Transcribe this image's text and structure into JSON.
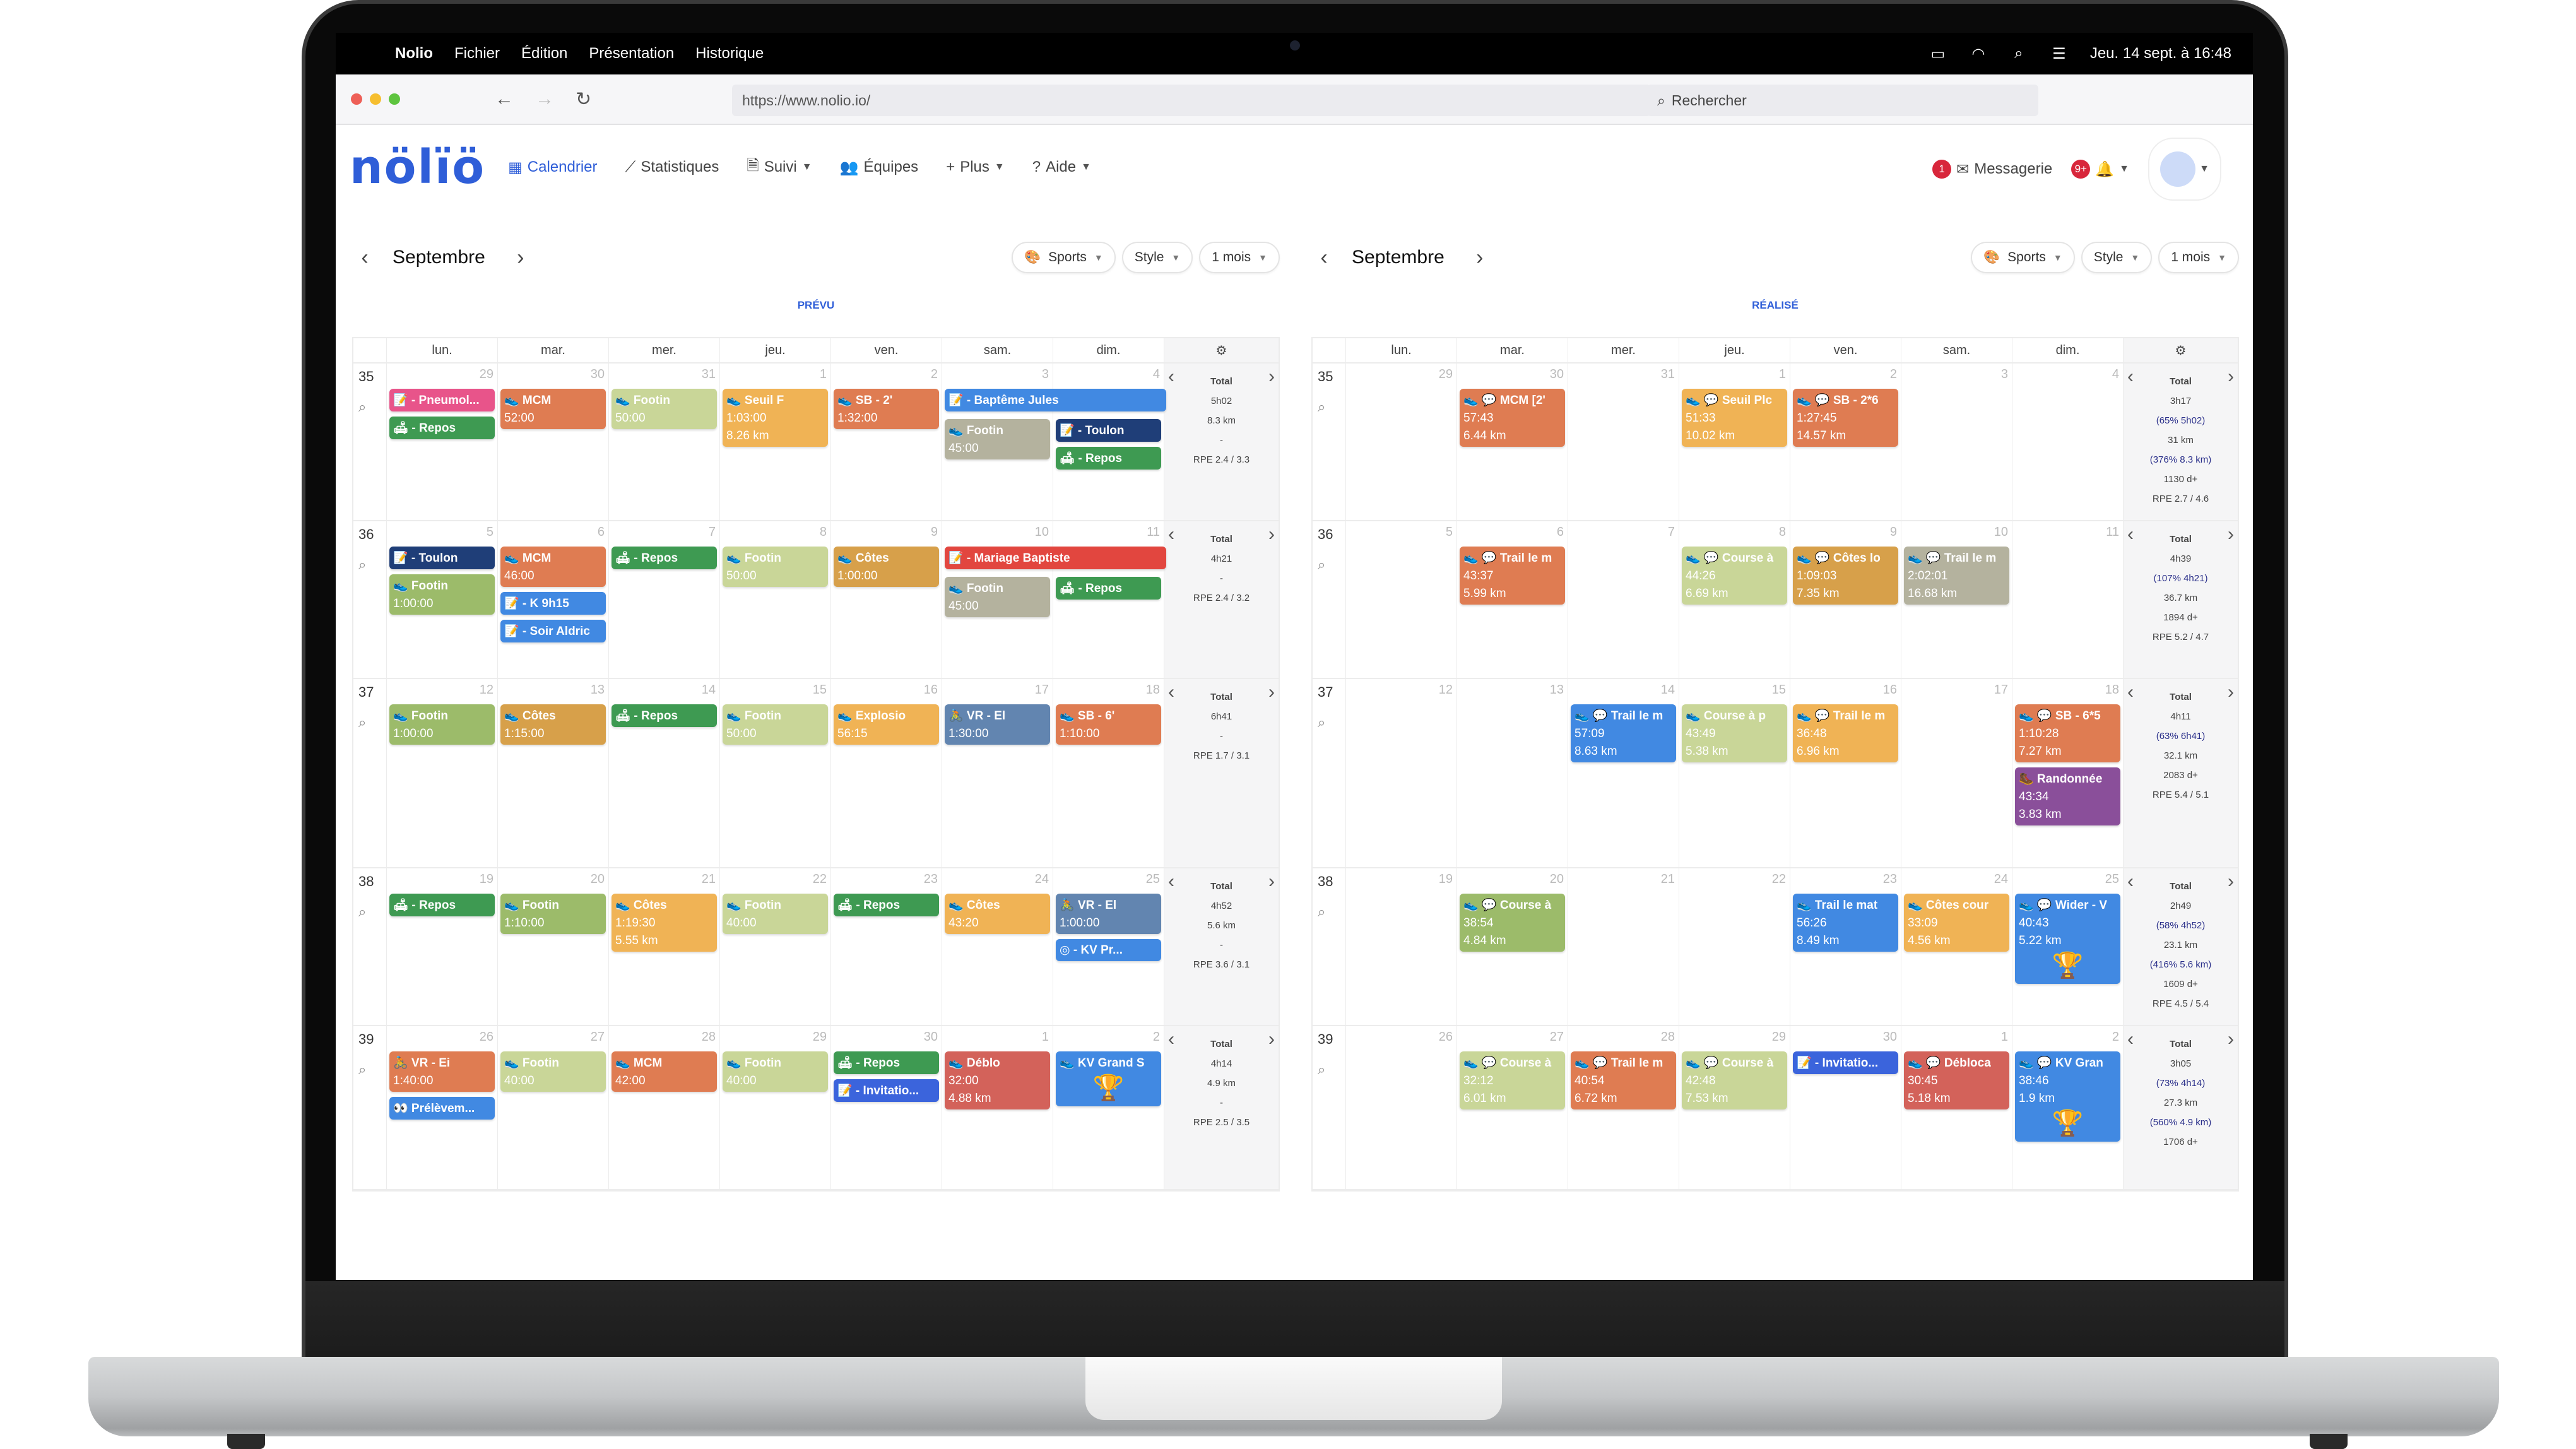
{
  "menubar": {
    "app": "Nolio",
    "items": [
      "Fichier",
      "Édition",
      "Présentation",
      "Historique"
    ],
    "datetime": "Jeu. 14 sept. à 16:48"
  },
  "browser": {
    "url": "https://www.nolio.io/",
    "search_placeholder": "Rechercher"
  },
  "app": {
    "logo": "nölïö",
    "nav": [
      {
        "label": "Calendrier",
        "icon": "calendar-icon",
        "active": true
      },
      {
        "label": "Statistiques",
        "icon": "chart-icon"
      },
      {
        "label": "Suivi",
        "icon": "document-icon",
        "dropdown": true
      },
      {
        "label": "Équipes",
        "icon": "team-icon"
      },
      {
        "label": "Plus",
        "icon": "plus-icon",
        "dropdown": true
      },
      {
        "label": "Aide",
        "icon": "question-icon",
        "dropdown": true
      }
    ],
    "messages_label": "Messagerie",
    "messages_badge": "1",
    "notifications_badge": "9+"
  },
  "days": [
    "lun.",
    "mar.",
    "mer.",
    "jeu.",
    "ven.",
    "sam.",
    "dim."
  ],
  "calendars": [
    {
      "month": "Septembre",
      "label": "PRÉVU",
      "filters": {
        "sports": "Sports",
        "style": "Style",
        "range": "1 mois"
      },
      "weeks": [
        {
          "num": "35",
          "dates": [
            "29",
            "30",
            "31",
            "1",
            "2",
            "3",
            "4"
          ],
          "total": [
            "Total",
            "5h02",
            "8.3 km",
            "-",
            "RPE 2.4 / 3.3"
          ],
          "days": [
            [
              {
                "c": "#e8548a",
                "t": "📝 - Pneumol...",
                "l": []
              },
              {
                "c": "#3e9a52",
                "t": "🛋 - Repos",
                "l": []
              }
            ],
            [
              {
                "c": "#df7c52",
                "t": "👟 MCM",
                "l": [
                  "52:00"
                ]
              }
            ],
            [
              {
                "c": "#c9d698",
                "t": "👟 Footin",
                "l": [
                  "50:00"
                ]
              }
            ],
            [
              {
                "c": "#f0b355",
                "t": "👟 Seuil F",
                "l": [
                  "1:03:00",
                  "8.26 km"
                ]
              }
            ],
            [
              {
                "c": "#df7c52",
                "t": "👟 SB - 2'",
                "l": [
                  "1:32:00"
                ]
              }
            ],
            [
              {
                "c": "#4189e2",
                "t": "📝 - Baptême Jules",
                "l": [],
                "span": 2
              },
              {
                "c": "#b4b29e",
                "t": "👟 Footin",
                "l": [
                  "45:00"
                ]
              }
            ],
            [
              {
                "c": "#1f3e78",
                "t": "📝 - Toulon",
                "l": []
              },
              {
                "c": "#3e9a52",
                "t": "🛋 - Repos",
                "l": []
              }
            ]
          ]
        },
        {
          "num": "36",
          "dates": [
            "5",
            "6",
            "7",
            "8",
            "9",
            "10",
            "11"
          ],
          "total": [
            "Total",
            "4h21",
            "-",
            "RPE 2.4 / 3.2"
          ],
          "days": [
            [
              {
                "c": "#1f3e78",
                "t": "📝 - Toulon",
                "l": []
              },
              {
                "c": "#9cbb6a",
                "t": "👟 Footin",
                "l": [
                  "1:00:00"
                ]
              }
            ],
            [
              {
                "c": "#df7c52",
                "t": "👟 MCM",
                "l": [
                  "46:00"
                ]
              },
              {
                "c": "#4189e2",
                "t": "📝 - K 9h15",
                "l": []
              },
              {
                "c": "#4189e2",
                "t": "📝 - Soir Aldric",
                "l": []
              }
            ],
            [
              {
                "c": "#3e9a52",
                "t": "🛋 - Repos",
                "l": []
              }
            ],
            [
              {
                "c": "#c9d698",
                "t": "👟 Footin",
                "l": [
                  "50:00"
                ]
              }
            ],
            [
              {
                "c": "#d7a04a",
                "t": "👟 Côtes",
                "l": [
                  "1:00:00"
                ]
              }
            ],
            [
              {
                "c": "#e2463f",
                "t": "📝 - Mariage Baptiste",
                "l": [],
                "span": 2
              },
              {
                "c": "#b4b29e",
                "t": "👟 Footin",
                "l": [
                  "45:00"
                ]
              }
            ],
            [
              {
                "c": "#3e9a52",
                "t": "🛋 - Repos",
                "l": []
              }
            ]
          ]
        },
        {
          "num": "37",
          "dates": [
            "12",
            "13",
            "14",
            "15",
            "16",
            "17",
            "18"
          ],
          "total": [
            "Total",
            "6h41",
            "-",
            "RPE 1.7 / 3.1"
          ],
          "days": [
            [
              {
                "c": "#9cbb6a",
                "t": "👟 Footin",
                "l": [
                  "1:00:00"
                ]
              }
            ],
            [
              {
                "c": "#d7a04a",
                "t": "👟 Côtes",
                "l": [
                  "1:15:00"
                ]
              }
            ],
            [
              {
                "c": "#3e9a52",
                "t": "🛋 - Repos",
                "l": []
              }
            ],
            [
              {
                "c": "#c9d698",
                "t": "👟 Footin",
                "l": [
                  "50:00"
                ]
              }
            ],
            [
              {
                "c": "#f0b355",
                "t": "👟 Explosio",
                "l": [
                  "56:15"
                ]
              }
            ],
            [
              {
                "c": "#6285b0",
                "t": "🚴 VR - El",
                "l": [
                  "1:30:00"
                ]
              }
            ],
            [
              {
                "c": "#df7c52",
                "t": "👟 SB - 6'",
                "l": [
                  "1:10:00"
                ]
              }
            ]
          ]
        },
        {
          "num": "38",
          "dates": [
            "19",
            "20",
            "21",
            "22",
            "23",
            "24",
            "25"
          ],
          "total": [
            "Total",
            "4h52",
            "5.6 km",
            "-",
            "RPE 3.6 / 3.1"
          ],
          "days": [
            [
              {
                "c": "#3e9a52",
                "t": "🛋 - Repos",
                "l": []
              }
            ],
            [
              {
                "c": "#9cbb6a",
                "t": "👟 Footin",
                "l": [
                  "1:10:00"
                ]
              }
            ],
            [
              {
                "c": "#f0b355",
                "t": "👟 Côtes",
                "l": [
                  "1:19:30",
                  "5.55 km"
                ]
              }
            ],
            [
              {
                "c": "#c9d698",
                "t": "👟 Footin",
                "l": [
                  "40:00"
                ]
              }
            ],
            [
              {
                "c": "#3e9a52",
                "t": "🛋 - Repos",
                "l": []
              }
            ],
            [
              {
                "c": "#f0b355",
                "t": "👟 Côtes",
                "l": [
                  "43:20"
                ]
              }
            ],
            [
              {
                "c": "#6285b0",
                "t": "🚴 VR - El",
                "l": [
                  "1:00:00"
                ]
              },
              {
                "c": "#4189e2",
                "t": "◎ - KV Pr...",
                "l": []
              }
            ]
          ]
        },
        {
          "num": "39",
          "dates": [
            "26",
            "27",
            "28",
            "29",
            "30",
            "1",
            "2"
          ],
          "total": [
            "Total",
            "4h14",
            "4.9 km",
            "-",
            "RPE 2.5 / 3.5"
          ],
          "days": [
            [
              {
                "c": "#df7c52",
                "t": "🚴 VR - Ei",
                "l": [
                  "1:40:00"
                ]
              },
              {
                "c": "#4189e2",
                "t": "👀 Prélèvem...",
                "l": []
              }
            ],
            [
              {
                "c": "#c9d698",
                "t": "👟 Footin",
                "l": [
                  "40:00"
                ]
              }
            ],
            [
              {
                "c": "#df7c52",
                "t": "👟 MCM",
                "l": [
                  "42:00"
                ]
              }
            ],
            [
              {
                "c": "#c9d698",
                "t": "👟 Footin",
                "l": [
                  "40:00"
                ]
              }
            ],
            [
              {
                "c": "#3e9a52",
                "t": "🛋 - Repos",
                "l": []
              },
              {
                "c": "#3b64dc",
                "t": "📝 - Invitatio...",
                "l": []
              }
            ],
            [
              {
                "c": "#d3625a",
                "t": "👟 Déblo",
                "l": [
                  "32:00",
                  "4.88 km"
                ]
              }
            ],
            [
              {
                "c": "#4189e2",
                "t": "👟 KV Grand S",
                "l": [],
                "trophy": true
              }
            ]
          ]
        }
      ]
    },
    {
      "month": "Septembre",
      "label": "RÉALISÉ",
      "filters": {
        "sports": "Sports",
        "style": "Style",
        "range": "1 mois"
      },
      "weeks": [
        {
          "num": "35",
          "dates": [
            "29",
            "30",
            "31",
            "1",
            "2",
            "3",
            "4"
          ],
          "total": [
            "Total",
            "3h17",
            "(65% 5h02)",
            "31 km",
            "(376% 8.3 km)",
            "1130 d+",
            "RPE 2.7 / 4.6"
          ],
          "days": [
            [],
            [
              {
                "c": "#df7c52",
                "t": "👟 💬 MCM [2'",
                "l": [
                  "57:43",
                  "6.44 km"
                ]
              }
            ],
            [],
            [
              {
                "c": "#f0b355",
                "t": "👟 💬 Seuil Plc",
                "l": [
                  "51:33",
                  "10.02 km"
                ]
              }
            ],
            [
              {
                "c": "#df7c52",
                "t": "👟 💬 SB - 2*6",
                "l": [
                  "1:27:45",
                  "14.57 km"
                ]
              }
            ],
            [],
            []
          ]
        },
        {
          "num": "36",
          "dates": [
            "5",
            "6",
            "7",
            "8",
            "9",
            "10",
            "11"
          ],
          "total": [
            "Total",
            "4h39",
            "(107% 4h21)",
            "36.7 km",
            "1894 d+",
            "RPE 5.2 / 4.7"
          ],
          "days": [
            [],
            [
              {
                "c": "#df7c52",
                "t": "👟 💬 Trail le m",
                "l": [
                  "43:37",
                  "5.99 km"
                ]
              }
            ],
            [],
            [
              {
                "c": "#c9d698",
                "t": "👟 💬 Course à",
                "l": [
                  "44:26",
                  "6.69 km"
                ]
              }
            ],
            [
              {
                "c": "#d7a04a",
                "t": "👟 💬 Côtes lo",
                "l": [
                  "1:09:03",
                  "7.35 km"
                ]
              }
            ],
            [
              {
                "c": "#b4b29e",
                "t": "👟 💬 Trail le m",
                "l": [
                  "2:02:01",
                  "16.68 km"
                ]
              }
            ],
            []
          ]
        },
        {
          "num": "37",
          "dates": [
            "12",
            "13",
            "14",
            "15",
            "16",
            "17",
            "18"
          ],
          "total": [
            "Total",
            "4h11",
            "(63% 6h41)",
            "32.1 km",
            "2083 d+",
            "RPE 5.4 / 5.1"
          ],
          "days": [
            [],
            [],
            [
              {
                "c": "#4189e2",
                "t": "👟 💬 Trail le m",
                "l": [
                  "57:09",
                  "8.63 km"
                ]
              }
            ],
            [
              {
                "c": "#c9d698",
                "t": "👟 Course à p",
                "l": [
                  "43:49",
                  "5.38 km"
                ]
              }
            ],
            [
              {
                "c": "#f0b355",
                "t": "👟 💬 Trail le m",
                "l": [
                  "36:48",
                  "6.96 km"
                ]
              }
            ],
            [],
            [
              {
                "c": "#df7c52",
                "t": "👟 💬 SB - 6*5",
                "l": [
                  "1:10:28",
                  "7.27 km"
                ]
              },
              {
                "c": "#8a4f9a",
                "t": "🥾 Randonnée",
                "l": [
                  "43:34",
                  "3.83 km"
                ]
              }
            ]
          ]
        },
        {
          "num": "38",
          "dates": [
            "19",
            "20",
            "21",
            "22",
            "23",
            "24",
            "25"
          ],
          "total": [
            "Total",
            "2h49",
            "(58% 4h52)",
            "23.1 km",
            "(416% 5.6 km)",
            "1609 d+",
            "RPE 4.5 / 5.4"
          ],
          "days": [
            [],
            [
              {
                "c": "#9cbb6a",
                "t": "👟 💬 Course à",
                "l": [
                  "38:54",
                  "4.84 km"
                ]
              }
            ],
            [],
            [],
            [
              {
                "c": "#4189e2",
                "t": "👟 Trail le mat",
                "l": [
                  "56:26",
                  "8.49 km"
                ]
              }
            ],
            [
              {
                "c": "#f0b355",
                "t": "👟 Côtes cour",
                "l": [
                  "33:09",
                  "4.56 km"
                ]
              }
            ],
            [
              {
                "c": "#4189e2",
                "t": "👟 💬 Wider - V",
                "l": [
                  "40:43",
                  "5.22 km"
                ],
                "trophy": true
              }
            ]
          ]
        },
        {
          "num": "39",
          "dates": [
            "26",
            "27",
            "28",
            "29",
            "30",
            "1",
            "2"
          ],
          "total": [
            "Total",
            "3h05",
            "(73% 4h14)",
            "27.3 km",
            "(560% 4.9 km)",
            "1706 d+"
          ],
          "days": [
            [],
            [
              {
                "c": "#c9d698",
                "t": "👟 💬 Course à",
                "l": [
                  "32:12",
                  "6.01 km"
                ]
              }
            ],
            [
              {
                "c": "#df7c52",
                "t": "👟 💬 Trail le m",
                "l": [
                  "40:54",
                  "6.72 km"
                ]
              }
            ],
            [
              {
                "c": "#c9d698",
                "t": "👟 💬 Course à",
                "l": [
                  "42:48",
                  "7.53 km"
                ]
              }
            ],
            [
              {
                "c": "#3b64dc",
                "t": "📝 - Invitatio...",
                "l": []
              }
            ],
            [
              {
                "c": "#d3625a",
                "t": "👟 💬 Débloca",
                "l": [
                  "30:45",
                  "5.18 km"
                ]
              }
            ],
            [
              {
                "c": "#4189e2",
                "t": "👟 💬 KV Gran",
                "l": [
                  "38:46",
                  "1.9 km"
                ],
                "trophy": true
              }
            ]
          ]
        }
      ]
    }
  ],
  "colors": {
    "accent": "#2f5ed8",
    "badge": "#d8263b",
    "pct_text": "#2a2f8a"
  }
}
